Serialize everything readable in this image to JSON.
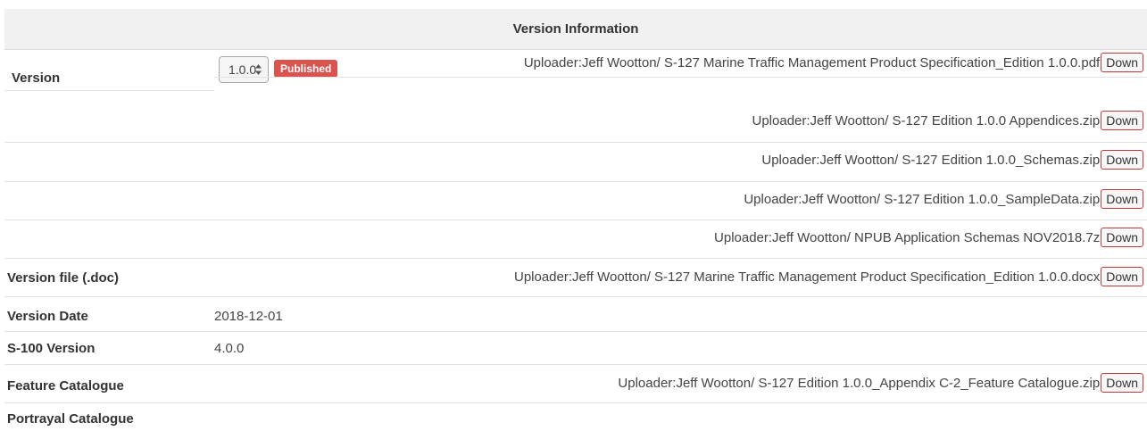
{
  "header": {
    "title": "Version Information"
  },
  "version": {
    "label": "Version",
    "selected": "1.0.0",
    "status_badge": "Published"
  },
  "files": [
    {
      "text": "Uploader:Jeff Wootton/ S-127 Marine Traffic Management Product Specification_Edition 1.0.0.pdf",
      "button": "Down"
    },
    {
      "text": "Uploader:Jeff Wootton/ S-127 Edition 1.0.0 Appendices.zip",
      "button": "Down"
    },
    {
      "text": "Uploader:Jeff Wootton/ S-127 Edition 1.0.0_Schemas.zip",
      "button": "Down"
    },
    {
      "text": "Uploader:Jeff Wootton/ S-127 Edition 1.0.0_SampleData.zip",
      "button": "Down"
    },
    {
      "text": "Uploader:Jeff Wootton/ NPUB Application Schemas NOV2018.7z",
      "button": "Down"
    }
  ],
  "version_file": {
    "label": "Version file (.doc)",
    "file": {
      "text": "Uploader:Jeff Wootton/ S-127 Marine Traffic Management Product Specification_Edition 1.0.0.docx",
      "button": "Down"
    }
  },
  "version_date": {
    "label": "Version Date",
    "value": "2018-12-01"
  },
  "s100_version": {
    "label": "S-100 Version",
    "value": "4.0.0"
  },
  "feature_catalogue": {
    "label": "Feature Catalogue",
    "file": {
      "text": "Uploader:Jeff Wootton/ S-127 Edition 1.0.0_Appendix C-2_Feature Catalogue.zip",
      "button": "Down"
    }
  },
  "portrayal_catalogue": {
    "label": "Portrayal Catalogue"
  },
  "colors": {
    "badge": "#d9534f",
    "button_border": "#c03a3a",
    "header_bg": "#f1f1f1"
  }
}
